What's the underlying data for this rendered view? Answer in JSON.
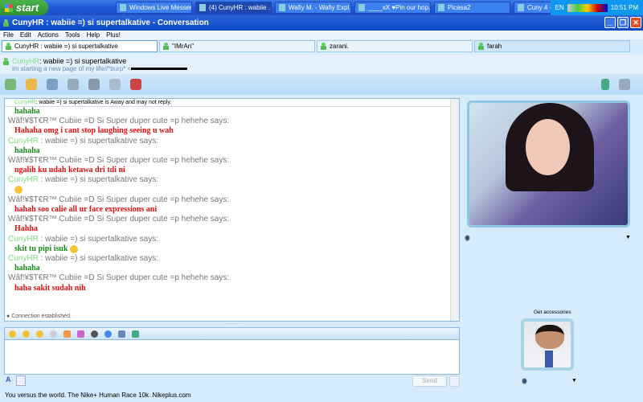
{
  "taskbar": {
    "start": "start",
    "buttons": [
      "Windows Live Messen...",
      "(4) CunyHR : wabiie ...",
      "Wafiy M. - Wafiy Expl...",
      "____xX ♥Pin our hop...",
      "Picasa2",
      "Cuny 4 - Paint"
    ],
    "lang": "EN",
    "clock": "10:51 PM"
  },
  "window": {
    "title": "CunyHR : wabiie =) si supertalkative - Conversation"
  },
  "menu": [
    "File",
    "Edit",
    "Actions",
    "Tools",
    "Help",
    "Plus!"
  ],
  "tabs": [
    "CunyHR : wabiie =) si supertalkative",
    "\"IMrAn\"",
    "zarani.",
    "farah"
  ],
  "contact": {
    "name_colored": "CunyHR",
    "name_rest": " : wabiie =) si supertalkative",
    "psm": "im starting a new page of my life//*burp* <"
  },
  "chat": {
    "away_colored": "CunyHR",
    "away_rest": " : wabiie =) si supertalkative is Away and may not reply.",
    "messages": [
      {
        "kind": "text",
        "color": "green",
        "text": "hahaha"
      },
      {
        "kind": "hd",
        "name": "Wâf!¥$T€R™ Cubiie =D Si Super duper cute =p hehehe says:"
      },
      {
        "kind": "text",
        "color": "red",
        "text": "Hahaha omg i cant stop laughing seeing u wah"
      },
      {
        "kind": "hdg",
        "name": "CunyHR",
        "rest": " : wabiie =) si supertalkative says:"
      },
      {
        "kind": "text",
        "color": "green",
        "text": "hahaha"
      },
      {
        "kind": "hd",
        "name": "Wâf!¥$T€R™ Cubiie =D Si Super duper cute =p hehehe says:"
      },
      {
        "kind": "text",
        "color": "red",
        "text": "ngalih ku udah ketawa dri tdi ni"
      },
      {
        "kind": "hdg",
        "name": "CunyHR",
        "rest": " : wabiie =) si supertalkative says:"
      },
      {
        "kind": "emoticon"
      },
      {
        "kind": "hd",
        "name": "Wâf!¥$T€R™ Cubiie =D Si Super duper cute =p hehehe says:"
      },
      {
        "kind": "text",
        "color": "red",
        "text": "hahah soo calie all ur face expressions ani"
      },
      {
        "kind": "hd",
        "name": "Wâf!¥$T€R™ Cubiie =D Si Super duper cute =p hehehe says:"
      },
      {
        "kind": "text",
        "color": "red",
        "text": "Hahha"
      },
      {
        "kind": "hdg",
        "name": "CunyHR",
        "rest": " : wabiie =) si supertalkative says:"
      },
      {
        "kind": "text",
        "color": "green",
        "text": "skit tu pipi isuk",
        "emoticon": true
      },
      {
        "kind": "hdg",
        "name": "CunyHR",
        "rest": " : wabiie =) si supertalkative says:"
      },
      {
        "kind": "text",
        "color": "green",
        "text": "hahaha"
      },
      {
        "kind": "hd",
        "name": "Wâf!¥$T€R™ Cubiie =D Si Super duper cute =p hehehe says:"
      },
      {
        "kind": "text",
        "color": "red",
        "text": "haha sakit sudah nih"
      }
    ],
    "connection": "Connection established."
  },
  "input": {
    "send": "Send",
    "font_icon": "A"
  },
  "sidebar": {
    "get_accessories": "Get accessories"
  },
  "status": "You versus the world. The Nike+ Human Race 10k. Nikeplus.com"
}
